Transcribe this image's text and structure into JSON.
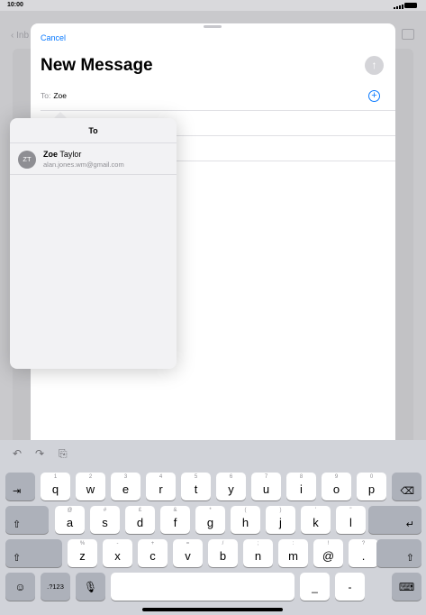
{
  "status_bar": {
    "time": "10:00"
  },
  "background": {
    "back_label": "Inb"
  },
  "compose": {
    "cancel_label": "Cancel",
    "title": "New Message",
    "send_icon": "arrow-up-icon",
    "to_label": "To:",
    "to_value": "Zoe",
    "add_contact_icon": "plus-circle-icon"
  },
  "suggestions": {
    "title": "To",
    "items": [
      {
        "initials": "ZT",
        "name_match": "Zoe",
        "name_rest": " Taylor",
        "email": "alan.jones.wm@gmail.com"
      }
    ]
  },
  "keyboard": {
    "toolbar": {
      "undo": "↶",
      "redo": "↷",
      "paste": "⎘"
    },
    "row1": [
      {
        "main": "q",
        "sub": "1"
      },
      {
        "main": "w",
        "sub": "2"
      },
      {
        "main": "e",
        "sub": "3"
      },
      {
        "main": "r",
        "sub": "4"
      },
      {
        "main": "t",
        "sub": "5"
      },
      {
        "main": "y",
        "sub": "6"
      },
      {
        "main": "u",
        "sub": "7"
      },
      {
        "main": "i",
        "sub": "8"
      },
      {
        "main": "o",
        "sub": "9"
      },
      {
        "main": "p",
        "sub": "0"
      }
    ],
    "row2": [
      {
        "main": "a",
        "sub": "@"
      },
      {
        "main": "s",
        "sub": "#"
      },
      {
        "main": "d",
        "sub": "£"
      },
      {
        "main": "f",
        "sub": "&"
      },
      {
        "main": "g",
        "sub": "*"
      },
      {
        "main": "h",
        "sub": "("
      },
      {
        "main": "j",
        "sub": ")"
      },
      {
        "main": "k",
        "sub": "'"
      },
      {
        "main": "l",
        "sub": "\""
      }
    ],
    "row3": [
      {
        "main": "z",
        "sub": "%"
      },
      {
        "main": "x",
        "sub": "-"
      },
      {
        "main": "c",
        "sub": "+"
      },
      {
        "main": "v",
        "sub": "="
      },
      {
        "main": "b",
        "sub": "/"
      },
      {
        "main": "n",
        "sub": ";"
      },
      {
        "main": "m",
        "sub": ":"
      },
      {
        "main": "@",
        "sub": "!"
      },
      {
        "main": ".",
        "sub": "?"
      }
    ],
    "tab_glyph": "⇥",
    "delete_glyph": "⌫",
    "shift_glyph": "⇧",
    "return_glyph": "↵",
    "emoji_glyph": "☺",
    "numbers_label": ".?123",
    "mic_glyph": "🎙",
    "underscore_label": "_",
    "dash_label": "-",
    "dismiss_glyph": "⌨"
  }
}
